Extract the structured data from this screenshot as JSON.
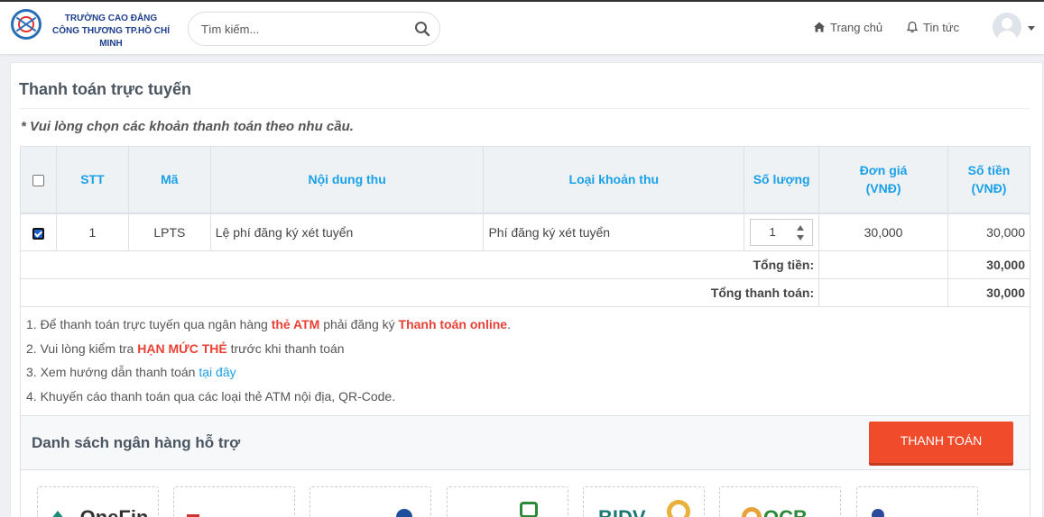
{
  "header": {
    "logo_line1": "TRƯỜNG CAO ĐẲNG",
    "logo_line2": "CÔNG THƯƠNG TP.HỒ CHÍ MINH",
    "search_placeholder": "Tìm kiếm...",
    "nav_home": "Trang chủ",
    "nav_news": "Tin tức"
  },
  "page": {
    "title": "Thanh toán trực tuyến",
    "note": "* Vui lòng chọn các khoản thanh toán theo nhu cầu."
  },
  "table": {
    "headers": {
      "stt": "STT",
      "code": "Mã",
      "content": "Nội dung thu",
      "type": "Loại khoản thu",
      "qty": "Số lượng",
      "unit_price_l1": "Đơn giá",
      "unit_price_l2": "(VNĐ)",
      "amount_l1": "Số tiền",
      "amount_l2": "(VNĐ)"
    },
    "rows": [
      {
        "checked": true,
        "stt": "1",
        "code": "LPTS",
        "content": "Lệ phí đăng ký xét tuyển",
        "type": "Phí đăng ký xét tuyển",
        "qty": "1",
        "unit_price": "30,000",
        "amount": "30,000"
      }
    ],
    "total_label": "Tổng tiền:",
    "total_value": "30,000",
    "grand_total_label": "Tổng thanh toán:",
    "grand_total_value": "30,000"
  },
  "info": {
    "line1_a": "1. Để thanh toán trực tuyến qua ngân hàng ",
    "line1_b": "thẻ ATM",
    "line1_c": " phải đăng ký ",
    "line1_d": "Thanh toán online",
    "line1_e": ".",
    "line2_a": "2. Vui lòng kiểm tra ",
    "line2_b": "HẠN MỨC THẺ",
    "line2_c": " trước khi thanh toán",
    "line3_a": "3. Xem hướng dẫn thanh toán ",
    "line3_link": "tại đây",
    "line4": "4. Khuyến cáo thanh toán qua các loại thẻ ATM nội địa, QR-Code."
  },
  "banks": {
    "title": "Danh sách ngân hàng hỗ trợ",
    "pay_button": "THANH TOÁN",
    "items": [
      {
        "label": "OneFin",
        "color": "#1a8a7a"
      },
      {
        "label": "",
        "color": "#c33"
      },
      {
        "label": "",
        "color": "#1d4f9a"
      },
      {
        "label": "",
        "color": "#2a8a3a"
      },
      {
        "label": "BIDV",
        "color": "#1a7a74"
      },
      {
        "label": "OCB",
        "color": "#2a8a3a"
      },
      {
        "label": "",
        "color": "#2a4a9a"
      }
    ]
  }
}
